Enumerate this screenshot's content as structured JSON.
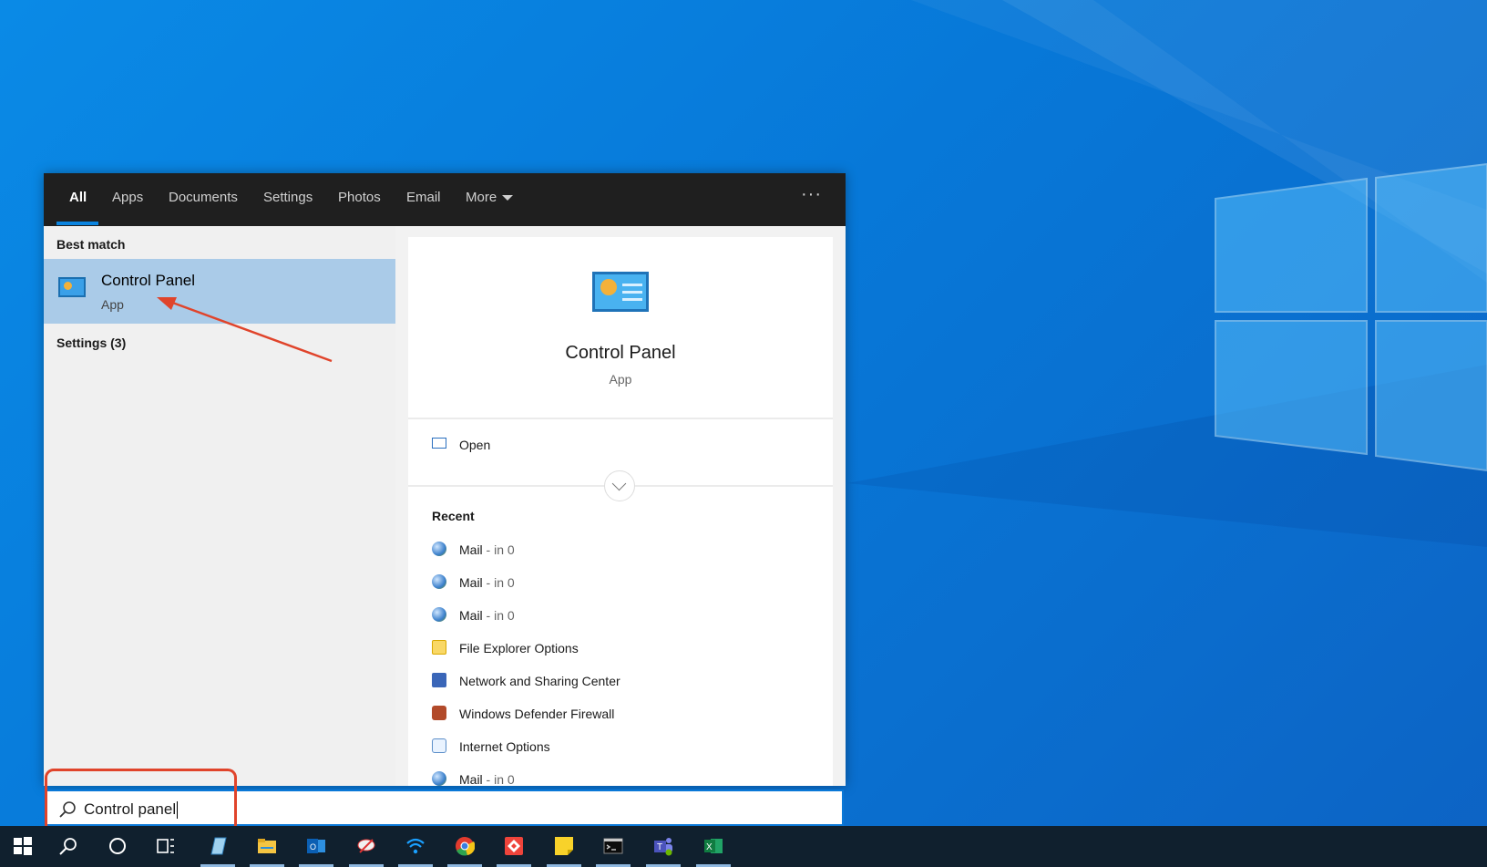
{
  "tabs": [
    {
      "label": "All",
      "active": true
    },
    {
      "label": "Apps"
    },
    {
      "label": "Documents"
    },
    {
      "label": "Settings"
    },
    {
      "label": "Photos"
    },
    {
      "label": "Email"
    },
    {
      "label": "More"
    }
  ],
  "overflow_label": "···",
  "left_pane": {
    "best_match_label": "Best match",
    "best_match": {
      "name": "Control Panel",
      "type": "App",
      "icon": "control-panel-icon"
    },
    "settings_label": "Settings (3)"
  },
  "preview": {
    "title": "Control Panel",
    "subtitle": "App",
    "open_label": "Open",
    "recent_label": "Recent",
    "recent_items": [
      {
        "name": "Mail",
        "suffix": " - in 0",
        "icon": "mail-globe-icon"
      },
      {
        "name": "Mail",
        "suffix": " - in 0",
        "icon": "mail-globe-icon"
      },
      {
        "name": "Mail",
        "suffix": " - in 0",
        "icon": "mail-globe-icon"
      },
      {
        "name": "File Explorer Options",
        "suffix": "",
        "icon": "folder-options-icon"
      },
      {
        "name": "Network and Sharing Center",
        "suffix": "",
        "icon": "network-icon"
      },
      {
        "name": "Windows Defender Firewall",
        "suffix": "",
        "icon": "firewall-icon"
      },
      {
        "name": "Internet Options",
        "suffix": "",
        "icon": "internet-options-icon"
      },
      {
        "name": "Mail",
        "suffix": " - in 0",
        "icon": "mail-globe-icon"
      }
    ]
  },
  "search": {
    "value": "Control panel"
  },
  "taskbar": {
    "items": [
      "start-icon",
      "search-icon",
      "cortana-icon",
      "task-view-icon",
      "notepad-icon",
      "file-explorer-icon",
      "outlook-icon",
      "snipping-icon",
      "wifi-icon",
      "chrome-icon",
      "anydesk-icon",
      "sticky-notes-icon",
      "terminal-icon",
      "teams-icon",
      "excel-icon"
    ]
  },
  "colors": {
    "accent": "#0a78d7",
    "selection": "#aacbe8",
    "annotation": "#e0442b",
    "taskbar": "#10202e"
  }
}
